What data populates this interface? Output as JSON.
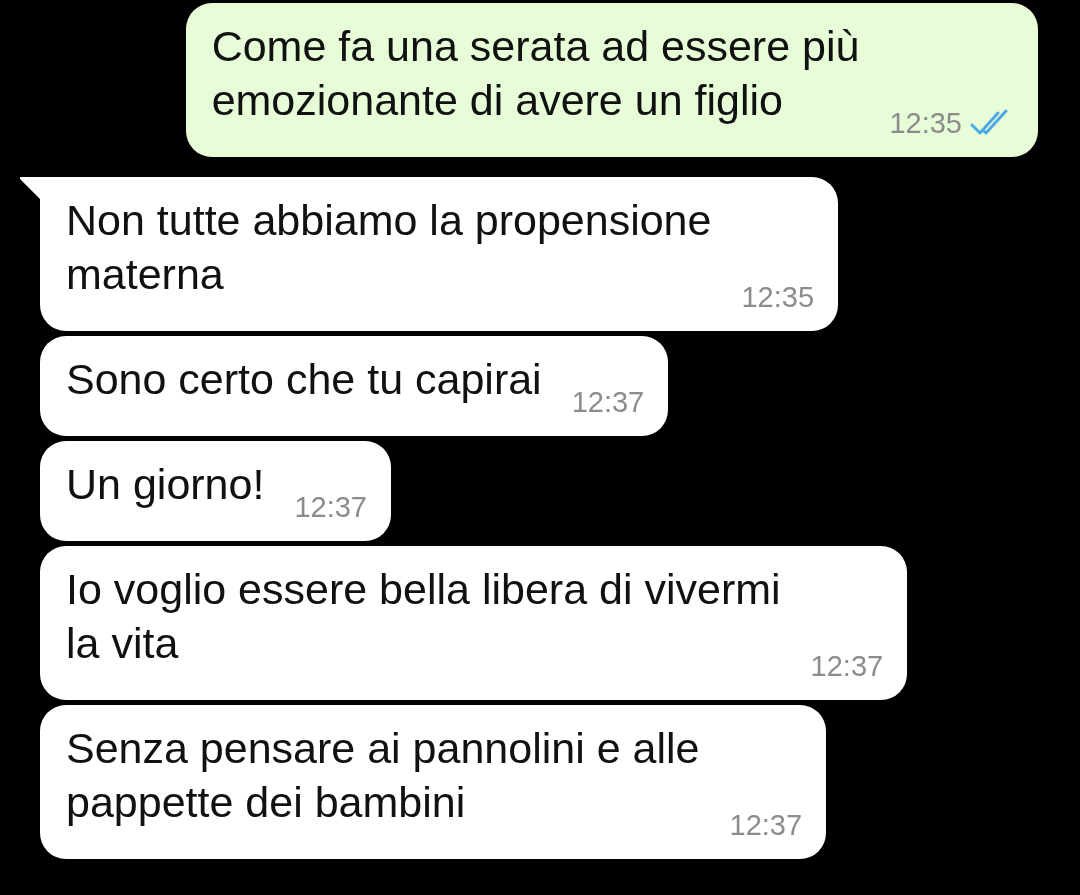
{
  "messages": [
    {
      "kind": "outgoing",
      "text": "Come fa una serata ad essere più\nemozionante di avere un figlio",
      "time": "12:35",
      "read": true,
      "tail": false
    },
    {
      "kind": "incoming",
      "text": "Non tutte abbiamo la propensione\nmaterna",
      "time": "12:35",
      "tail": true
    },
    {
      "kind": "incoming",
      "text": "Sono certo che tu capirai",
      "time": "12:37",
      "tail": false
    },
    {
      "kind": "incoming",
      "text": "Un giorno!",
      "time": "12:37",
      "tail": false
    },
    {
      "kind": "incoming",
      "text": "Io voglio essere bella libera di vivermi\nla vita",
      "time": "12:37",
      "tail": false
    },
    {
      "kind": "incoming",
      "text": "Senza pensare ai pannolini e alle\npappette dei bambini",
      "time": "12:37",
      "tail": false
    }
  ]
}
